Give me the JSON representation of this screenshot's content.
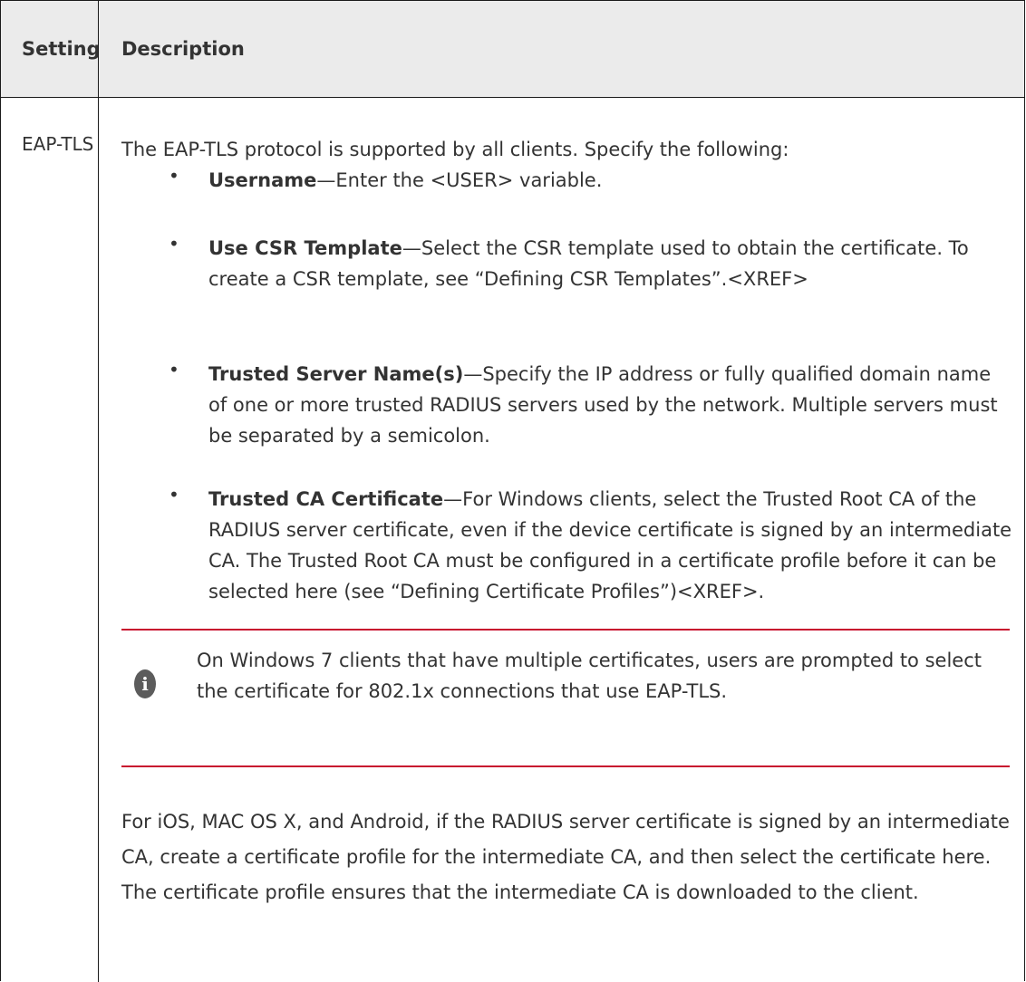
{
  "table": {
    "headers": {
      "setting": "Setting",
      "description": "Description"
    },
    "row": {
      "setting": "EAP-TLS",
      "intro": "The EAP-TLS protocol is supported by all clients. Specify the following:",
      "bullet_glyph": "•",
      "bullets": [
        {
          "term": "Username",
          "text": "—Enter the <USER> variable."
        },
        {
          "term": "Use CSR Template",
          "text": "—Select the CSR template used to obtain the certificate. To create a CSR template, see “Defining CSR Templates”.<XREF>"
        },
        {
          "term": "Trusted Server Name(s)",
          "text": "—Specify the IP address or fully qualified domain name of one or more trusted RADIUS servers used by the network. Multiple servers must be separated by a semicolon."
        },
        {
          "term": "Trusted CA Certificate",
          "text": "—For Windows clients, select the Trusted Root CA of the RADIUS server certificate, even if the device certificate is signed by an intermediate CA. The Trusted Root CA must be configured in a certificate profile before it can be selected here (see “Defining Certificate Profiles”)<XREF>."
        }
      ],
      "note": {
        "icon": "info-icon",
        "icon_glyph": "i",
        "text": "On Windows 7 clients that have multiple certificates, users are prompted to select the certificate for 802.1x connections that use EAP-TLS."
      },
      "footer": "For iOS, MAC OS X, and Android, if the RADIUS server certificate is signed by an intermediate CA, create a certificate profile for the intermediate CA, and then select the certificate here. The certificate profile ensures that the intermediate CA is downloaded to the client."
    },
    "colors": {
      "header_bg": "#ebebeb",
      "border": "#1a1a1a",
      "accent_red": "#c8102e",
      "text": "#333333"
    }
  }
}
